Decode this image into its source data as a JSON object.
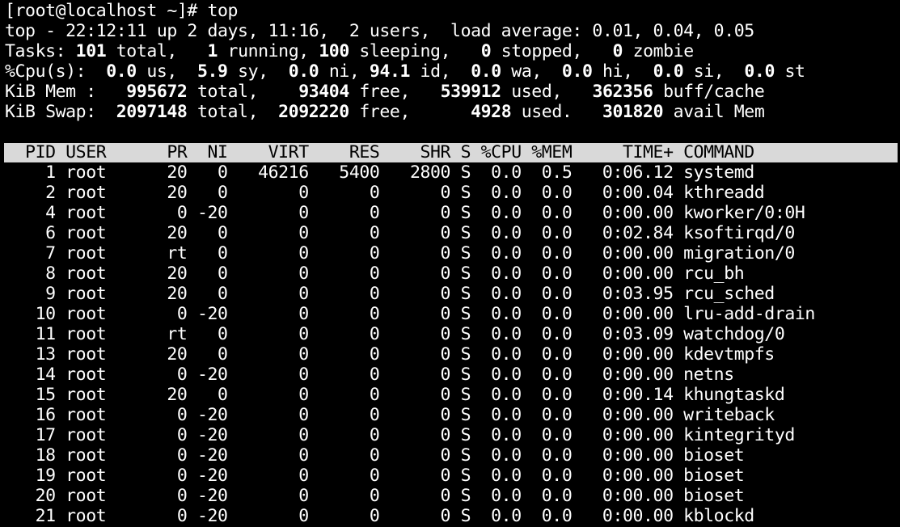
{
  "prompt": {
    "text": "[root@localhost ~]# ",
    "command": "top"
  },
  "summary": {
    "uptime": "top - 22:12:11 up 2 days, 11:16,  2 users,  load average: 0.01, 0.04, 0.05",
    "tasks": {
      "label": "Tasks: ",
      "total": "101",
      "total_label": " total,   ",
      "running": "1",
      "running_label": " running, ",
      "sleeping": "100",
      "sleeping_label": " sleeping,   ",
      "stopped": "0",
      "stopped_label": " stopped,   ",
      "zombie": "0",
      "zombie_label": " zombie"
    },
    "cpu": {
      "label": "%Cpu(s):  ",
      "us": "0.0",
      "us_label": " us,  ",
      "sy": "5.9",
      "sy_label": " sy,  ",
      "ni": "0.0",
      "ni_label": " ni, ",
      "id": "94.1",
      "id_label": " id,  ",
      "wa": "0.0",
      "wa_label": " wa,  ",
      "hi": "0.0",
      "hi_label": " hi,  ",
      "si": "0.0",
      "si_label": " si,  ",
      "st": "0.0",
      "st_label": " st"
    },
    "mem": {
      "label": "KiB Mem :   ",
      "total": "995672",
      "total_label": " total,    ",
      "free": "93404",
      "free_label": " free,   ",
      "used": "539912",
      "used_label": " used,   ",
      "buff": "362356",
      "buff_label": " buff/cache"
    },
    "swap": {
      "label": "KiB Swap:  ",
      "total": "2097148",
      "total_label": " total,  ",
      "free": "2092220",
      "free_label": " free,      ",
      "used": "4928",
      "used_label": " used.   ",
      "avail": "301820",
      "avail_label": " avail Mem"
    }
  },
  "table": {
    "header": "  PID USER      PR  NI    VIRT    RES    SHR S %CPU %MEM     TIME+ COMMAND",
    "rows": [
      "    1 root      20   0   46216   5400   2800 S  0.0  0.5   0:06.12 systemd",
      "    2 root      20   0       0      0      0 S  0.0  0.0   0:00.04 kthreadd",
      "    4 root       0 -20       0      0      0 S  0.0  0.0   0:00.00 kworker/0:0H",
      "    6 root      20   0       0      0      0 S  0.0  0.0   0:02.84 ksoftirqd/0",
      "    7 root      rt   0       0      0      0 S  0.0  0.0   0:00.00 migration/0",
      "    8 root      20   0       0      0      0 S  0.0  0.0   0:00.00 rcu_bh",
      "    9 root      20   0       0      0      0 S  0.0  0.0   0:03.95 rcu_sched",
      "   10 root       0 -20       0      0      0 S  0.0  0.0   0:00.00 lru-add-drain",
      "   11 root      rt   0       0      0      0 S  0.0  0.0   0:03.09 watchdog/0",
      "   13 root      20   0       0      0      0 S  0.0  0.0   0:00.00 kdevtmpfs",
      "   14 root       0 -20       0      0      0 S  0.0  0.0   0:00.00 netns",
      "   15 root      20   0       0      0      0 S  0.0  0.0   0:00.14 khungtaskd",
      "   16 root       0 -20       0      0      0 S  0.0  0.0   0:00.00 writeback",
      "   17 root       0 -20       0      0      0 S  0.0  0.0   0:00.00 kintegrityd",
      "   18 root       0 -20       0      0      0 S  0.0  0.0   0:00.00 bioset",
      "   19 root       0 -20       0      0      0 S  0.0  0.0   0:00.00 bioset",
      "   20 root       0 -20       0      0      0 S  0.0  0.0   0:00.00 bioset",
      "   21 root       0 -20       0      0      0 S  0.0  0.0   0:00.00 kblockd"
    ]
  },
  "colors": {
    "background": "#000000",
    "foreground": "#ffffff",
    "header_bar": "#d9d9d9",
    "header_text": "#000000"
  }
}
